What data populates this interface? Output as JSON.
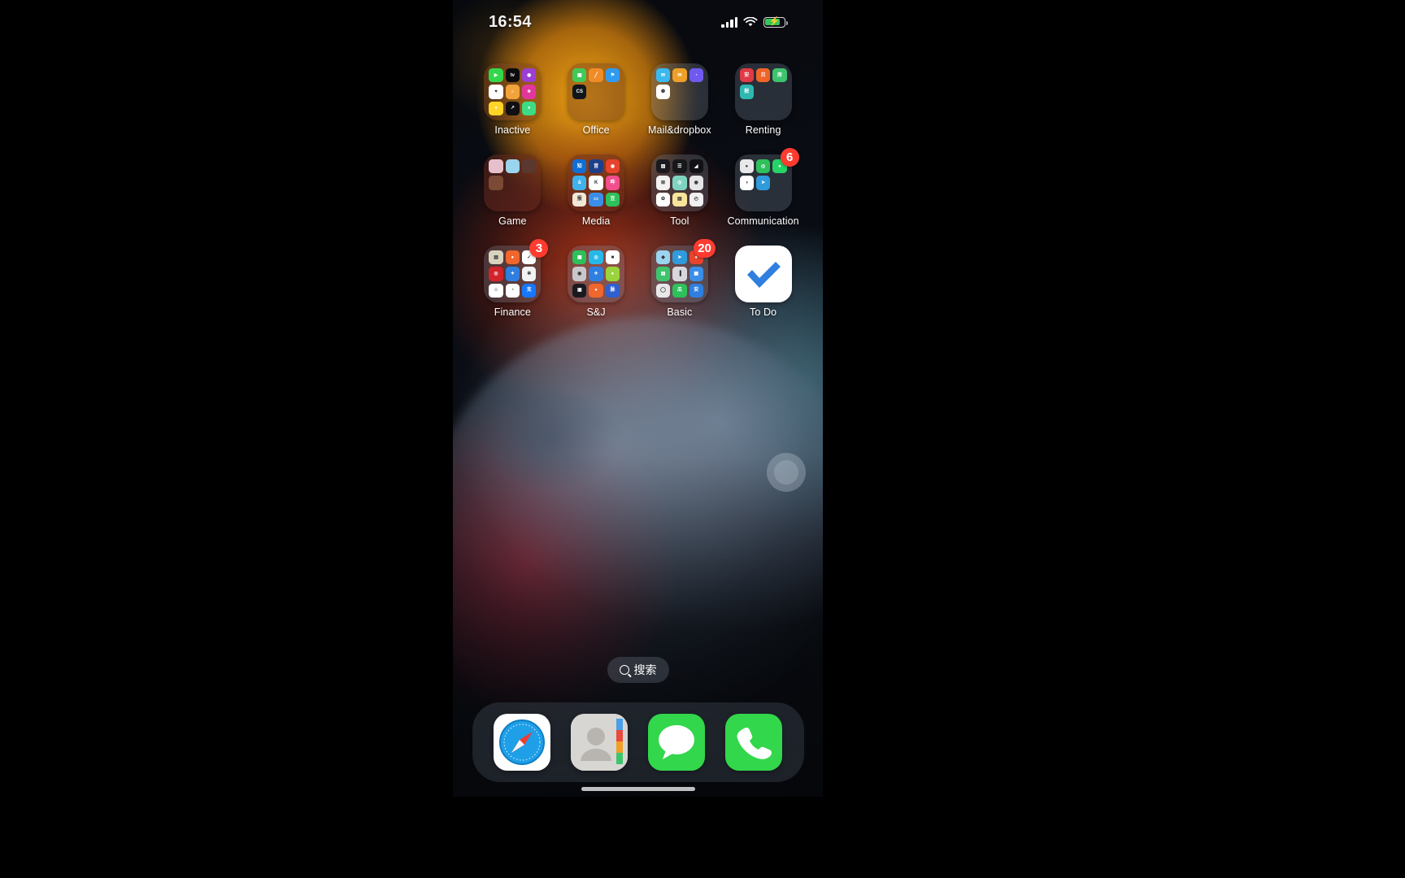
{
  "status_bar": {
    "time": "16:54",
    "signal_icon": "cellular-signal-icon",
    "wifi_icon": "wifi-icon",
    "battery_icon": "battery-charging-icon",
    "battery_glyph": "⚡"
  },
  "home_screen": {
    "rows": [
      [
        {
          "label": "Inactive",
          "type": "folder",
          "tint": "warm",
          "badge": null,
          "mini_apps": [
            {
              "name": "facetime",
              "color": "#32d74b",
              "glyph": "▶"
            },
            {
              "name": "apple-tv",
              "color": "#0b0b0d",
              "glyph": "tv"
            },
            {
              "name": "podcasts",
              "color": "#9b3fd4",
              "glyph": "◉"
            },
            {
              "name": "health",
              "color": "#ffffff",
              "glyph": "♥"
            },
            {
              "name": "home",
              "color": "#f2a33c",
              "glyph": "⌂"
            },
            {
              "name": "itunes-store",
              "color": "#e0379c",
              "glyph": "★"
            },
            {
              "name": "tips",
              "color": "#ffd426",
              "glyph": "●"
            },
            {
              "name": "stocks",
              "color": "#101014",
              "glyph": "↗"
            },
            {
              "name": "fitness",
              "color": "#3ddc84",
              "glyph": "●"
            }
          ]
        },
        {
          "label": "Office",
          "type": "folder",
          "tint": "warm",
          "badge": null,
          "mini_apps": [
            {
              "name": "numbers",
              "color": "#41c95a",
              "glyph": "▦"
            },
            {
              "name": "pages",
              "color": "#f08c28",
              "glyph": "╱"
            },
            {
              "name": "keynote",
              "color": "#2f9bf0",
              "glyph": "⚑"
            },
            {
              "name": "cs-app",
              "color": "#11161c",
              "glyph": "CS"
            }
          ]
        },
        {
          "label": "Mail&dropbox",
          "type": "folder",
          "tint": "cool",
          "badge": null,
          "mini_apps": [
            {
              "name": "mail-blue",
              "color": "#39b9f0",
              "glyph": "✉"
            },
            {
              "name": "mail-orange",
              "color": "#f0a028",
              "glyph": "✉"
            },
            {
              "name": "dropbox-purple",
              "color": "#6f5af0",
              "glyph": "◔"
            },
            {
              "name": "share-app",
              "color": "#ffffff",
              "glyph": "❁"
            }
          ]
        },
        {
          "label": "Renting",
          "type": "folder",
          "tint": "cool",
          "badge": null,
          "mini_apps": [
            {
              "name": "renting-red",
              "color": "#e03a46",
              "glyph": "安"
            },
            {
              "name": "renting-orange",
              "color": "#f06428",
              "glyph": "贝"
            },
            {
              "name": "renting-green",
              "color": "#3ec46d",
              "glyph": "房"
            },
            {
              "name": "renting-teal",
              "color": "#2fb8b0",
              "glyph": "税"
            }
          ]
        }
      ],
      [
        {
          "label": "Game",
          "type": "folder",
          "tint": "warmdeep",
          "badge": null,
          "mini_apps": [
            {
              "name": "game-anime-1",
              "color": "#e8c0cc",
              "glyph": ""
            },
            {
              "name": "game-blue",
              "color": "#9ad4ee",
              "glyph": ""
            },
            {
              "name": "game-dark",
              "color": "#5a3830",
              "glyph": ""
            },
            {
              "name": "game-brown",
              "color": "#7a4a34",
              "glyph": ""
            }
          ]
        },
        {
          "label": "Media",
          "type": "folder",
          "tint": "warmdeep",
          "badge": null,
          "mini_apps": [
            {
              "name": "zhihu",
              "color": "#0f6fd6",
              "glyph": "知"
            },
            {
              "name": "netease-music",
              "color": "#1f3f8a",
              "glyph": "音"
            },
            {
              "name": "weibo",
              "color": "#e8432c",
              "glyph": "◉"
            },
            {
              "name": "ximalaya",
              "color": "#3fb2ee",
              "glyph": "&"
            },
            {
              "name": "kuaishou",
              "color": "#ffffff",
              "glyph": "K"
            },
            {
              "name": "bilibili",
              "color": "#f24e8e",
              "glyph": "哔"
            },
            {
              "name": "news-app",
              "color": "#f2e8d8",
              "glyph": "报"
            },
            {
              "name": "video-blue",
              "color": "#3b8ee8",
              "glyph": "▭"
            },
            {
              "name": "douban",
              "color": "#2ec05a",
              "glyph": "豆"
            }
          ]
        },
        {
          "label": "Tool",
          "type": "folder",
          "tint": "cool",
          "badge": null,
          "mini_apps": [
            {
              "name": "scanner-dark",
              "color": "#1a1a1e",
              "glyph": "▨"
            },
            {
              "name": "reminders-dark",
              "color": "#17171b",
              "glyph": "☰"
            },
            {
              "name": "measure-dark",
              "color": "#121216",
              "glyph": "◢"
            },
            {
              "name": "calculator",
              "color": "#f2f2f2",
              "glyph": "⊞"
            },
            {
              "name": "camera-green",
              "color": "#7fd4c0",
              "glyph": "◎"
            },
            {
              "name": "camera-dark",
              "color": "#e6e6e8",
              "glyph": "◉"
            },
            {
              "name": "photos",
              "color": "#ffffff",
              "glyph": "✿"
            },
            {
              "name": "notes",
              "color": "#f7e69a",
              "glyph": "▤"
            },
            {
              "name": "clock",
              "color": "#f0f0f2",
              "glyph": "◴"
            }
          ]
        },
        {
          "label": "Communication",
          "type": "folder",
          "tint": "cool",
          "badge": "6",
          "mini_apps": [
            {
              "name": "qq-app",
              "color": "#e8e8ea",
              "glyph": "●"
            },
            {
              "name": "wechat",
              "color": "#2ec05a",
              "glyph": "◎"
            },
            {
              "name": "whatsapp",
              "color": "#25d366",
              "glyph": "●"
            },
            {
              "name": "dingtalk",
              "color": "#ffffff",
              "glyph": "◑"
            },
            {
              "name": "telegram",
              "color": "#2f9bdc",
              "glyph": "➤"
            }
          ]
        }
      ],
      [
        {
          "label": "Finance",
          "type": "folder",
          "tint": "cool",
          "badge": "3",
          "mini_apps": [
            {
              "name": "wallet-card",
              "color": "#d8d2be",
              "glyph": "▤"
            },
            {
              "name": "finance-orange",
              "color": "#f0662c",
              "glyph": "●"
            },
            {
              "name": "finance-white",
              "color": "#ffffff",
              "glyph": "✓"
            },
            {
              "name": "finance-red",
              "color": "#d2232a",
              "glyph": "◎"
            },
            {
              "name": "finance-blue",
              "color": "#2f7fe0",
              "glyph": "✦"
            },
            {
              "name": "finance-pink",
              "color": "#f2f2f4",
              "glyph": "✻"
            },
            {
              "name": "finance-face",
              "color": "#ffffff",
              "glyph": "☺"
            },
            {
              "name": "finance-cyan",
              "color": "#ffffff",
              "glyph": "◔"
            },
            {
              "name": "alipay",
              "color": "#1677ff",
              "glyph": "支"
            }
          ]
        },
        {
          "label": "S&J",
          "type": "folder",
          "tint": "cool",
          "badge": null,
          "mini_apps": [
            {
              "name": "sj-green",
              "color": "#2ec05a",
              "glyph": "▦"
            },
            {
              "name": "sj-cyan",
              "color": "#26b8e8",
              "glyph": "◎"
            },
            {
              "name": "sj-white",
              "color": "#ffffff",
              "glyph": "■"
            },
            {
              "name": "sj-camera",
              "color": "#c8c8cc",
              "glyph": "◉"
            },
            {
              "name": "sj-blue",
              "color": "#2f7fe0",
              "glyph": "✈"
            },
            {
              "name": "sj-lime",
              "color": "#9ad43c",
              "glyph": "●"
            },
            {
              "name": "sj-dark",
              "color": "#1a1a1e",
              "glyph": "▣"
            },
            {
              "name": "sj-orange",
              "color": "#f0662c",
              "glyph": "●"
            },
            {
              "name": "sj-maimai",
              "color": "#2f5fd0",
              "glyph": "脉"
            }
          ]
        },
        {
          "label": "Basic",
          "type": "folder",
          "tint": "cool",
          "badge": "20",
          "mini_apps": [
            {
              "name": "basic-maps",
              "color": "#9ad4ee",
              "glyph": "◆"
            },
            {
              "name": "basic-telegram",
              "color": "#2f9bdc",
              "glyph": "➤"
            },
            {
              "name": "basic-red",
              "color": "#e8432c",
              "glyph": "●"
            },
            {
              "name": "basic-green",
              "color": "#3ec46d",
              "glyph": "▤"
            },
            {
              "name": "basic-chart",
              "color": "#d8d8dc",
              "glyph": "▐"
            },
            {
              "name": "basic-blue",
              "color": "#3b8ee8",
              "glyph": "▦"
            },
            {
              "name": "basic-chat",
              "color": "#e8e8ea",
              "glyph": "◯"
            },
            {
              "name": "basic-guazi",
              "color": "#2ec05a",
              "glyph": "瓜"
            },
            {
              "name": "basic-home",
              "color": "#2f7fe0",
              "glyph": "安"
            }
          ]
        },
        {
          "label": "To Do",
          "type": "app",
          "icon": "checkmark-icon",
          "icon_color": "#2f7fe0",
          "badge": null
        }
      ]
    ]
  },
  "search": {
    "label": "搜索",
    "icon": "search-icon"
  },
  "dock": {
    "items": [
      {
        "label": "Safari",
        "name": "safari-icon",
        "color": "#ffffff"
      },
      {
        "label": "Contacts",
        "name": "contacts-icon",
        "color": "#d8d6d2"
      },
      {
        "label": "Messages",
        "name": "messages-icon",
        "color": "#32d74b"
      },
      {
        "label": "Phone",
        "name": "phone-icon",
        "color": "#32d74b"
      }
    ]
  },
  "accessibility": {
    "assistive_touch": "assistive-touch-button"
  }
}
